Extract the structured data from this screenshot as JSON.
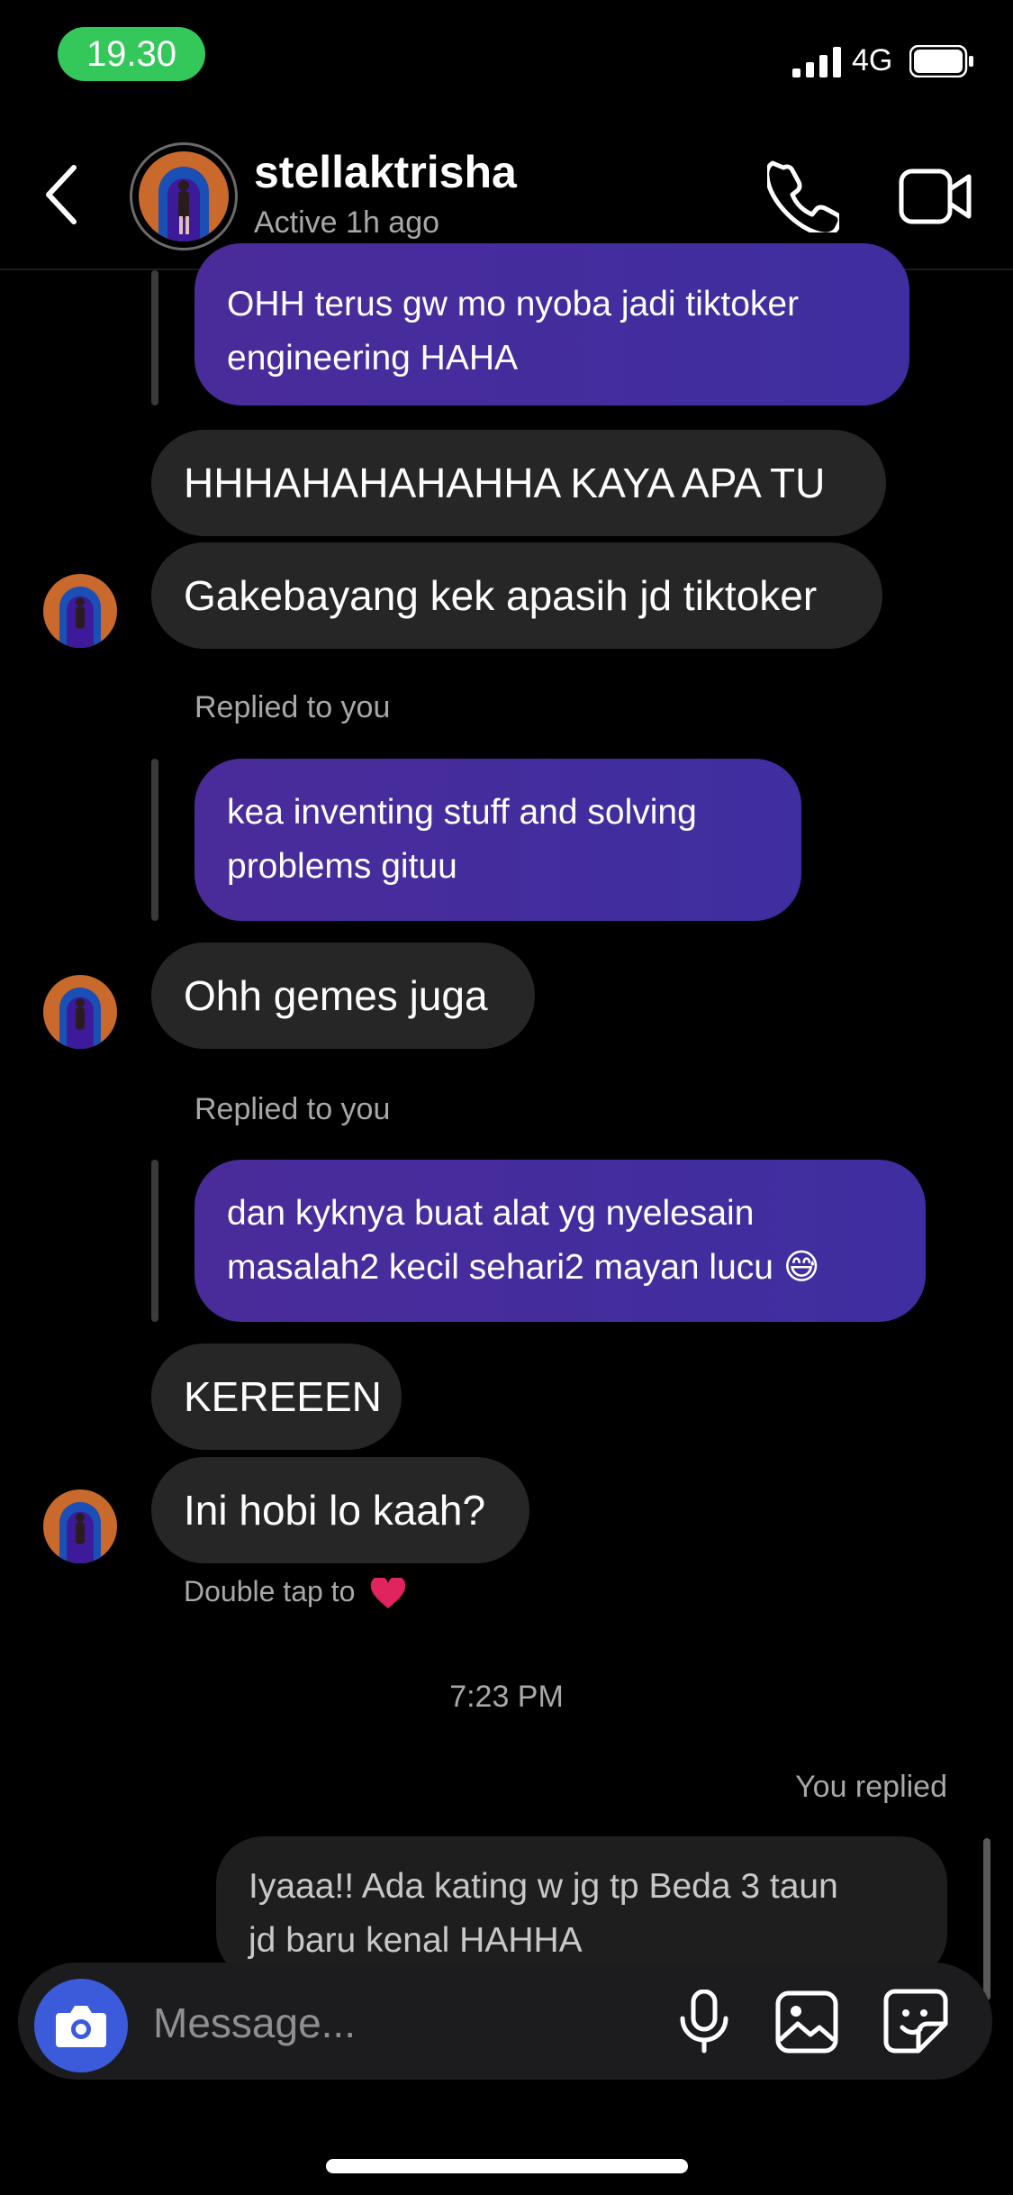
{
  "status_bar": {
    "time": "19.30",
    "network": "4G"
  },
  "header": {
    "username": "stellaktrisha",
    "activity": "Active 1h ago"
  },
  "messages": [
    {
      "kind": "outgoing-reply",
      "lines": [
        "OHH terus gw mo nyoba jadi tiktoker",
        "engineering HAHA"
      ]
    },
    {
      "kind": "incoming",
      "text": "HHHAHAHAHAHHA KAYA APA TU"
    },
    {
      "kind": "incoming",
      "text": "Gakebayang kek apasih jd tiktoker"
    },
    {
      "kind": "meta",
      "text": "Replied to you"
    },
    {
      "kind": "outgoing-reply",
      "lines": [
        "kea inventing stuff and solving",
        "problems gituu"
      ]
    },
    {
      "kind": "incoming",
      "text": "Ohh gemes juga"
    },
    {
      "kind": "meta",
      "text": "Replied to you"
    },
    {
      "kind": "outgoing-reply",
      "lines": [
        "dan kyknya buat alat yg nyelesain",
        "masalah2 kecil sehari2 mayan lucu 😅"
      ]
    },
    {
      "kind": "incoming",
      "text": "KEREEEN"
    },
    {
      "kind": "incoming",
      "text": "Ini hobi lo kaah?"
    },
    {
      "kind": "hint",
      "text": "Double tap to"
    },
    {
      "kind": "timestamp",
      "text": "7:23 PM"
    },
    {
      "kind": "meta",
      "text": "You replied"
    },
    {
      "kind": "own-reply",
      "lines": [
        "Iyaaa!! Ada kating w jg tp Beda 3 taun",
        "jd baru kenal HAHHA"
      ]
    }
  ],
  "composer": {
    "placeholder": "Message..."
  },
  "colors": {
    "accent_blue": "#3b5bdb",
    "bubble_purple": "#4a2b9a",
    "status_green": "#34c759"
  },
  "icons": [
    "back-icon",
    "call-icon",
    "video-icon",
    "camera-icon",
    "mic-icon",
    "gallery-icon",
    "sticker-icon",
    "heart-icon"
  ]
}
